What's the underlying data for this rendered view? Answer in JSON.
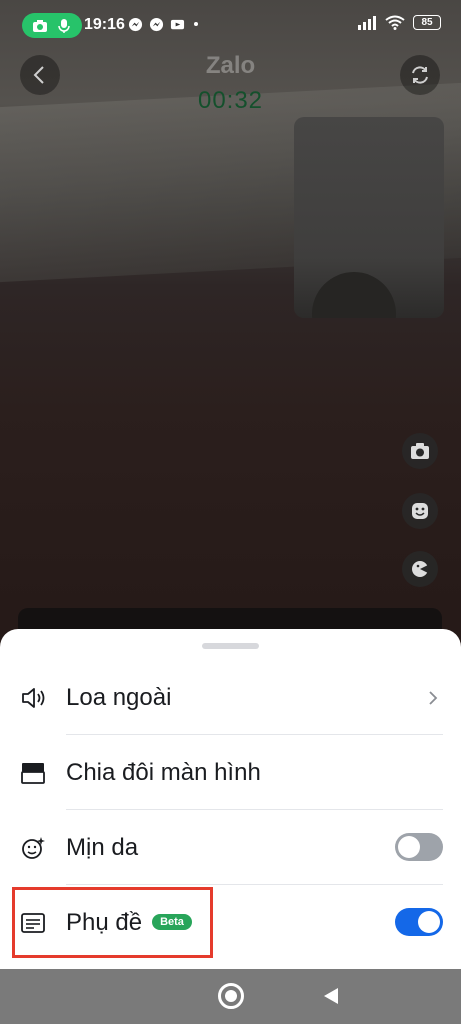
{
  "status_bar": {
    "time": "19:16",
    "battery": "85",
    "icons_left": [
      "camera-icon",
      "mic-icon",
      "messenger-icon",
      "messenger-icon",
      "video-call-icon"
    ],
    "icons_right": [
      "signal-icon",
      "wifi-icon",
      "battery-icon"
    ]
  },
  "call": {
    "app_name": "Zalo",
    "timer": "00:32"
  },
  "side_controls": [
    "camera-icon",
    "face-filter-icon",
    "effect-icon"
  ],
  "sheet": {
    "items": [
      {
        "label": "Loa ngoài",
        "icon": "speaker-icon",
        "control": "chevron"
      },
      {
        "label": "Chia đôi màn hình",
        "icon": "split-screen-icon",
        "control": "none"
      },
      {
        "label": "Mịn da",
        "icon": "smooth-skin-icon",
        "control": "toggle",
        "toggle_on": false
      },
      {
        "label": "Phụ đề",
        "icon": "subtitles-icon",
        "control": "toggle",
        "toggle_on": true,
        "badge": "Beta"
      }
    ]
  },
  "colors": {
    "accent": "#1468e8",
    "badge": "#28a55a",
    "highlight": "#e53b2c",
    "recording": "#27c36a"
  }
}
